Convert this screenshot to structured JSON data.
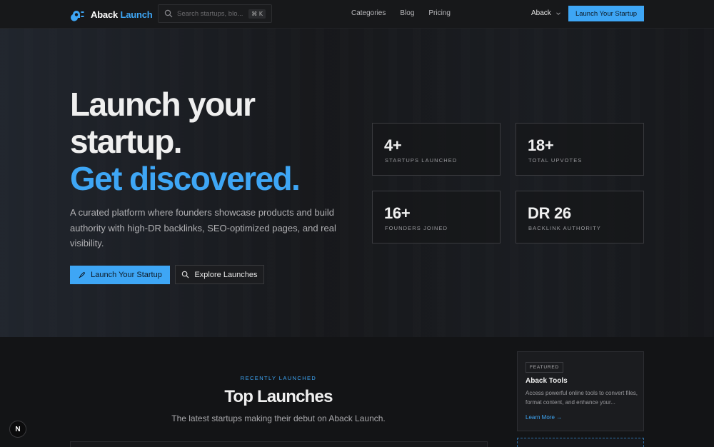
{
  "nav": {
    "brand_first": "Aback",
    "brand_second": "Launch",
    "search_placeholder": "Search startups, blo...",
    "search_shortcut": "⌘ K",
    "links": [
      "Categories",
      "Blog",
      "Pricing"
    ],
    "user_label": "Aback",
    "cta_label": "Launch Your Startup"
  },
  "hero": {
    "title_line1": "Launch your",
    "title_line2": "startup.",
    "title_line3": "Get discovered.",
    "description": "A curated platform where founders showcase products and build authority with high-DR backlinks, SEO-optimized pages, and real visibility.",
    "primary_cta": "Launch Your Startup",
    "secondary_cta": "Explore Launches",
    "stats": [
      {
        "value": "4+",
        "label": "STARTUPS LAUNCHED"
      },
      {
        "value": "18+",
        "label": "TOTAL UPVOTES"
      },
      {
        "value": "16+",
        "label": "FOUNDERS JOINED"
      },
      {
        "value": "DR 26",
        "label": "BACKLINK AUTHORITY"
      }
    ]
  },
  "launches": {
    "eyebrow": "RECENTLY LAUNCHED",
    "title": "Top Launches",
    "subtitle": "The latest startups making their debut on Aback Launch."
  },
  "featured": {
    "badge": "FEATURED",
    "title": "Aback Tools",
    "description": "Access powerful online tools to convert files, format content, and enhance your...",
    "link": "Learn More →"
  },
  "dev_badge": "N",
  "colors": {
    "accent": "#3ea6f5",
    "background": "#131416"
  }
}
